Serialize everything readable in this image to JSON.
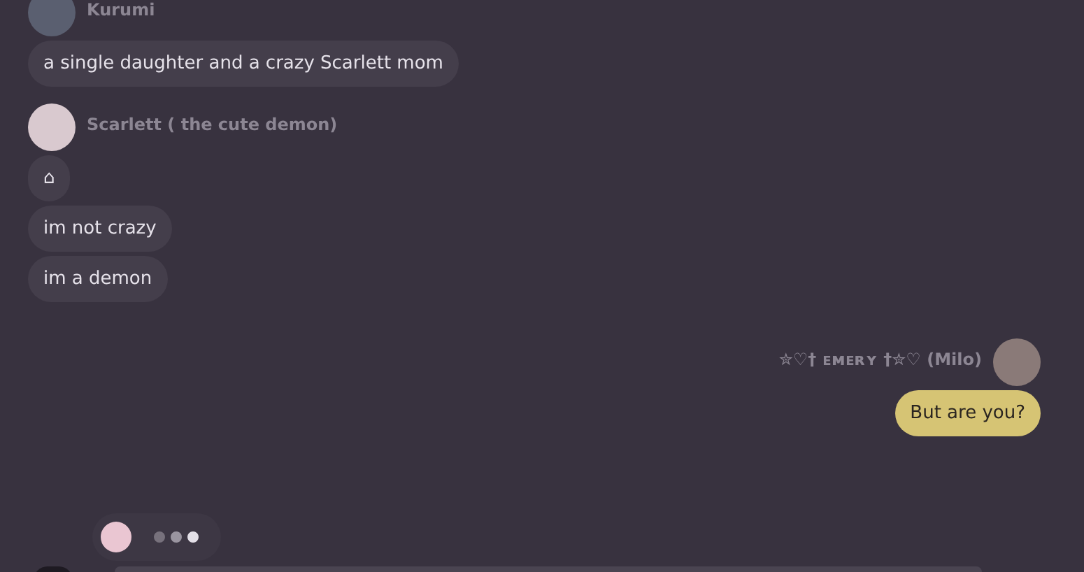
{
  "messages": [
    {
      "kind": "incoming",
      "author": "Kurumi",
      "bubbles": [
        "a single daughter and a crazy Scarlett mom"
      ]
    },
    {
      "kind": "incoming",
      "author": "Scarlett ( the cute demon)",
      "bubbles": [
        "⌂",
        "im not crazy",
        "im a demon"
      ]
    },
    {
      "kind": "outgoing",
      "author": "✮♡† ᴇᴍᴇʀʏ †✮♡ (Milo)",
      "bubbles": [
        "But are you?"
      ]
    }
  ]
}
